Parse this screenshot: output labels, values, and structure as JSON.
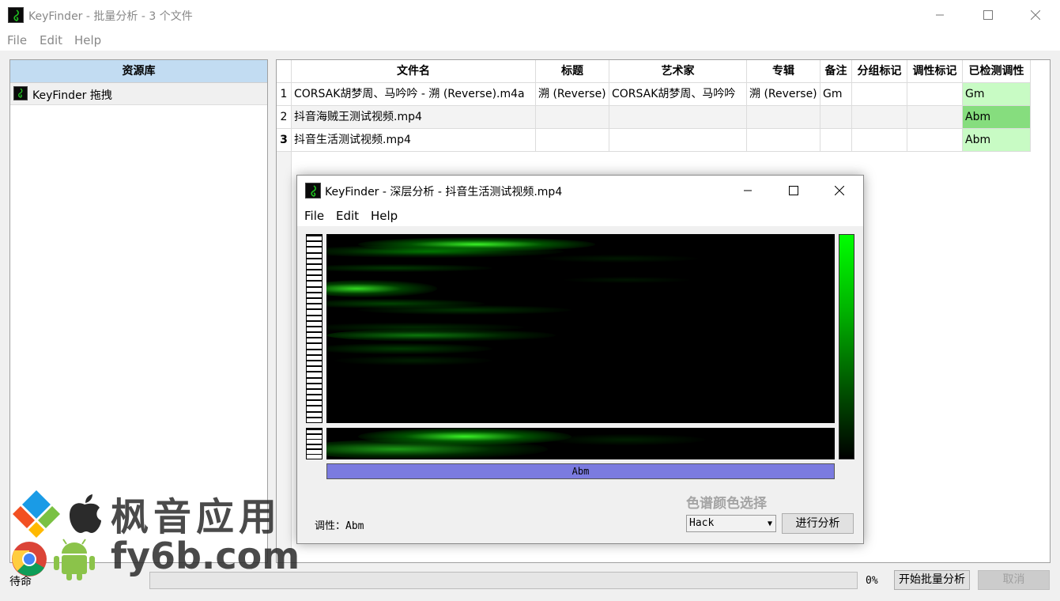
{
  "main_window": {
    "title": "KeyFinder - 批量分析 - 3 个文件",
    "menu": [
      "File",
      "Edit",
      "Help"
    ]
  },
  "library": {
    "header": "资源库",
    "items": [
      {
        "label": "KeyFinder 拖拽"
      }
    ]
  },
  "table": {
    "columns": [
      "文件名",
      "标题",
      "艺术家",
      "专辑",
      "备注",
      "分组标记",
      "调性标记",
      "已检测调性"
    ],
    "rows": [
      {
        "num": "1",
        "filename": "CORSAK胡梦周、马吟吟 - 溯 (Reverse).m4a",
        "title": "溯 (Reverse)",
        "artist": "CORSAK胡梦周、马吟吟",
        "album": "溯 (Reverse)",
        "comment": "Gm",
        "grouping": "",
        "key_tag": "",
        "detected_key": "Gm"
      },
      {
        "num": "2",
        "filename": "抖音海贼王测试视频.mp4",
        "title": "",
        "artist": "",
        "album": "",
        "comment": "",
        "grouping": "",
        "key_tag": "",
        "detected_key": "Abm"
      },
      {
        "num": "3",
        "filename": "抖音生活测试视频.mp4",
        "title": "",
        "artist": "",
        "album": "",
        "comment": "",
        "grouping": "",
        "key_tag": "",
        "detected_key": "Abm"
      }
    ]
  },
  "bottom": {
    "status": "待命",
    "progress_percent": 0,
    "progress_text": "0%",
    "start_button": "开始批量分析",
    "cancel_button": "取消"
  },
  "dialog": {
    "title": "KeyFinder - 深层分析 - 抖音生活测试视频.mp4",
    "menu": [
      "File",
      "Edit",
      "Help"
    ],
    "key_bar": "Abm",
    "scheme_label": "色谱颜色选择",
    "scheme_selected": "Hack",
    "run_button": "进行分析",
    "result_label": "调性：Abm"
  },
  "watermark": {
    "line1": "枫音应用",
    "line2": "fy6b.com"
  },
  "colors": {
    "library_header": "#c2dcf2",
    "key_light": "#c8fbc4",
    "key_dark": "#86dd7e",
    "key_bar": "#7b7be0",
    "spectrum_green": "#00ff00"
  },
  "icons": [
    "keyfinder-app-icon",
    "minimize-icon",
    "maximize-icon",
    "close-icon",
    "dropdown-arrow-icon",
    "windows-logo-icon",
    "apple-icon",
    "chrome-icon",
    "android-icon"
  ]
}
